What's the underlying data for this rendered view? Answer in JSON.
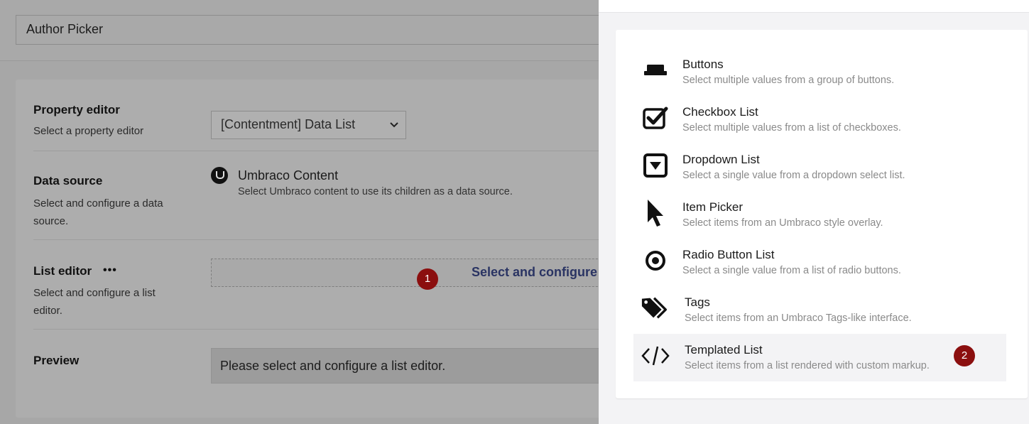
{
  "editor": {
    "name_value": "Author Picker",
    "property_editor": {
      "label": "Property editor",
      "description": "Select a property editor",
      "selected": "[Contentment] Data List",
      "chevron": "⌄"
    },
    "data_source": {
      "label": "Data source",
      "description": "Select and configure a data source.",
      "item_title": "Umbraco Content",
      "item_description": "Select Umbraco content to use its children as a data source.",
      "icon": "umbraco-logo-icon"
    },
    "list_editor": {
      "label": "List editor",
      "more": "•••",
      "description": "Select and configure a list editor.",
      "placeholder_text": "Select and configure a lis"
    },
    "preview": {
      "label": "Preview",
      "text": "Please select and configure a list editor."
    }
  },
  "annotations": {
    "badge_1": "1",
    "badge_2": "2",
    "color": "#8b0f0f"
  },
  "list_editors": [
    {
      "title": "Buttons",
      "description": "Select multiple values from a group of buttons.",
      "icon": "button-icon"
    },
    {
      "title": "Checkbox List",
      "description": "Select multiple values from a list of checkboxes.",
      "icon": "checkbox-icon"
    },
    {
      "title": "Dropdown List",
      "description": "Select a single value from a dropdown select list.",
      "icon": "dropdown-icon"
    },
    {
      "title": "Item Picker",
      "description": "Select items from an Umbraco style overlay.",
      "icon": "cursor-arrow-icon"
    },
    {
      "title": "Radio Button List",
      "description": "Select a single value from a list of radio buttons.",
      "icon": "radio-button-icon"
    },
    {
      "title": "Tags",
      "description": "Select items from an Umbraco Tags-like interface.",
      "icon": "tags-icon"
    },
    {
      "title": "Templated List",
      "description": "Select items from a list rendered with custom markup.",
      "icon": "code-icon",
      "highlighted": true
    }
  ]
}
